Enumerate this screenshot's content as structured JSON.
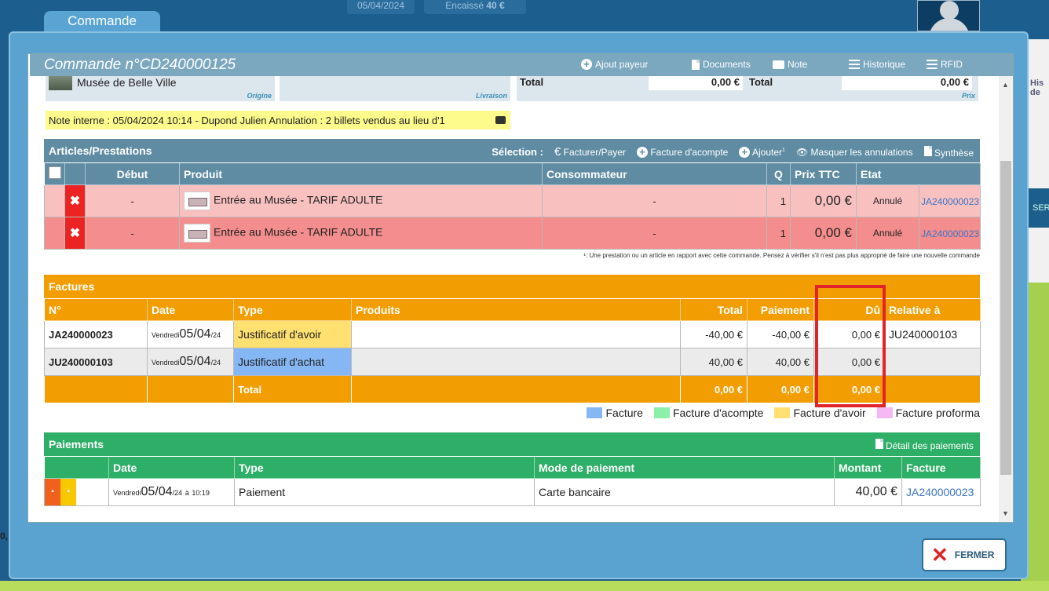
{
  "background": {
    "tab": "Commande",
    "date_chip": "05/04/2024",
    "encaisse_label": "Encaissé",
    "encaisse_value": "40 €",
    "right_text_1": "His",
    "right_text_2": "de",
    "right_text_3": "SER",
    "left_text": "0,"
  },
  "order": {
    "title": "Commande n°CD240000125",
    "actions": [
      "Ajout payeur",
      "Documents",
      "Note",
      "Historique",
      "RFID"
    ]
  },
  "header": {
    "origin_name": "Musée de Belle Ville",
    "origin_label": "Origine",
    "livraison_label": "Livraison",
    "total_label_1": "Total",
    "total_value_1": "0,00 €",
    "total_label_2": "Total",
    "total_value_2": "0,00 €",
    "prix_label": "Prix"
  },
  "note": {
    "text": "Note interne : 05/04/2024 10:14 - Dupond Julien Annulation : 2 billets vendus au lieu d'1"
  },
  "articles": {
    "title": "Articles/Prestations",
    "selection_label": "Sélection :",
    "actions": [
      "Facturer/Payer",
      "Facture d'acompte",
      "Ajouter",
      "Masquer les annulations",
      "Synthèse"
    ],
    "ajouter_sup": "1",
    "columns": [
      "Début",
      "Produit",
      "Consommateur",
      "Q",
      "Prix TTC",
      "Etat"
    ],
    "rows": [
      {
        "debut": "-",
        "produit": "Entrée au Musée - TARIF ADULTE",
        "consommateur": "-",
        "q": "1",
        "prix": "0,00 €",
        "etat": "Annulé",
        "ref": "JA240000023"
      },
      {
        "debut": "-",
        "produit": "Entrée au Musée - TARIF ADULTE",
        "consommateur": "-",
        "q": "1",
        "prix": "0,00 €",
        "etat": "Annulé",
        "ref": "JA240000023"
      }
    ],
    "footnote": "¹: Une prestation ou un article en rapport avec cette commande. Pensez à vérifier s'il n'est pas plus approprié de faire une nouvelle commande"
  },
  "factures": {
    "title": "Factures",
    "columns": [
      "N°",
      "Date",
      "Type",
      "Produits",
      "Total",
      "Paiement",
      "Dû",
      "Relative à"
    ],
    "rows": [
      {
        "num": "JA240000023",
        "day": "Vendredi",
        "date": "05/04",
        "year": "/24",
        "type": "Justificatif d'avoir",
        "produits": "",
        "total": "-40,00 €",
        "paiement": "-40,00 €",
        "du": "0,00 €",
        "relative": "JU240000103",
        "type_color": "#ffe070"
      },
      {
        "num": "JU240000103",
        "day": "Vendredi",
        "date": "05/04",
        "year": "/24",
        "type": "Justificatif d'achat",
        "produits": "",
        "total": "40,00 €",
        "paiement": "40,00 €",
        "du": "0,00 €",
        "relative": "",
        "type_color": "#86b7f5"
      }
    ],
    "total_row": {
      "label": "Total",
      "total": "0,00 €",
      "paiement": "0,00 €",
      "du": "0,00 €"
    },
    "legend": [
      {
        "label": "Facture",
        "color": "#86b7f5"
      },
      {
        "label": "Facture d'acompte",
        "color": "#8ef0a8"
      },
      {
        "label": "Facture d'avoir",
        "color": "#ffe070"
      },
      {
        "label": "Facture proforma",
        "color": "#f4b9f4"
      }
    ]
  },
  "paiements": {
    "title": "Paiements",
    "detail_action": "Détail des paiements",
    "columns": [
      "Date",
      "Type",
      "Mode de paiement",
      "Montant",
      "Facture"
    ],
    "rows": [
      {
        "day": "Vendredi",
        "date": "05/04",
        "year": "/24",
        "at": "à",
        "time": "10:19",
        "type": "Paiement",
        "mode": "Carte bancaire",
        "montant": "40,00 €",
        "facture": "JA240000023"
      }
    ]
  },
  "close_button": "FERMER"
}
